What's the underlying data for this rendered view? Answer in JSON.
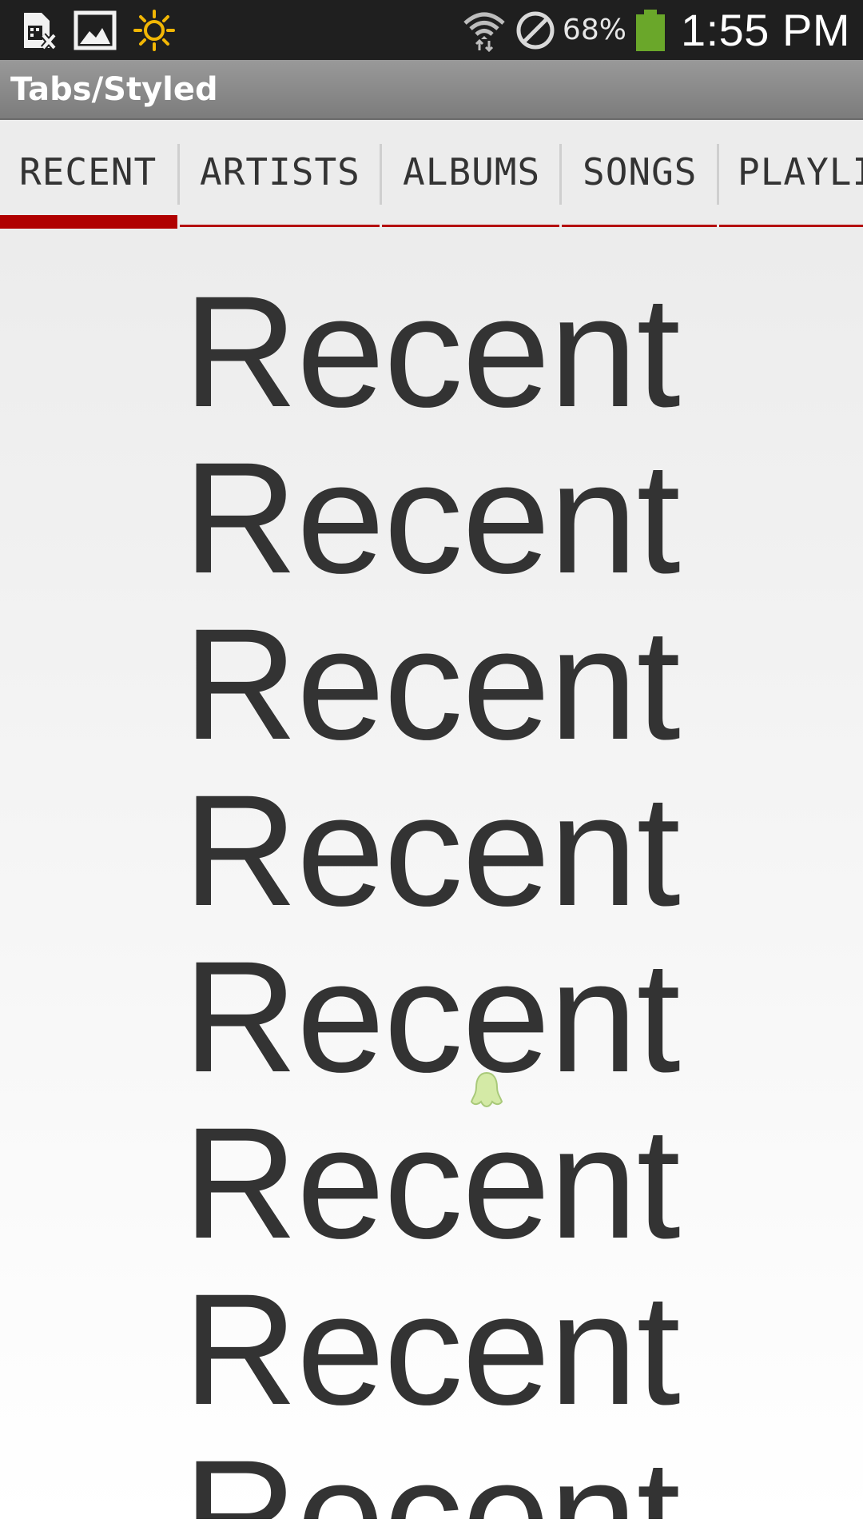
{
  "status_bar": {
    "icons_left": [
      "sim-card-error-icon",
      "image-icon",
      "brightness-icon"
    ],
    "icons_right": [
      "wifi-icon",
      "do-not-disturb-icon",
      "battery-icon"
    ],
    "battery_percent": "68%",
    "time": "1:55 PM",
    "colors": {
      "background": "#1f1f1f",
      "battery": "#6aa72a",
      "brightness": "#f2b705"
    }
  },
  "action_bar": {
    "title": "Tabs/Styled"
  },
  "tabs": [
    {
      "label": "RECENT",
      "selected": true
    },
    {
      "label": "ARTISTS",
      "selected": false
    },
    {
      "label": "ALBUMS",
      "selected": false
    },
    {
      "label": "SONGS",
      "selected": false
    },
    {
      "label": "PLAYLISTS",
      "selected": false
    }
  ],
  "tab_accent_color": "#b00000",
  "content": {
    "items": [
      "Recent",
      "Recent",
      "Recent",
      "Recent",
      "Recent",
      "Recent",
      "Recent",
      "Recent"
    ]
  }
}
